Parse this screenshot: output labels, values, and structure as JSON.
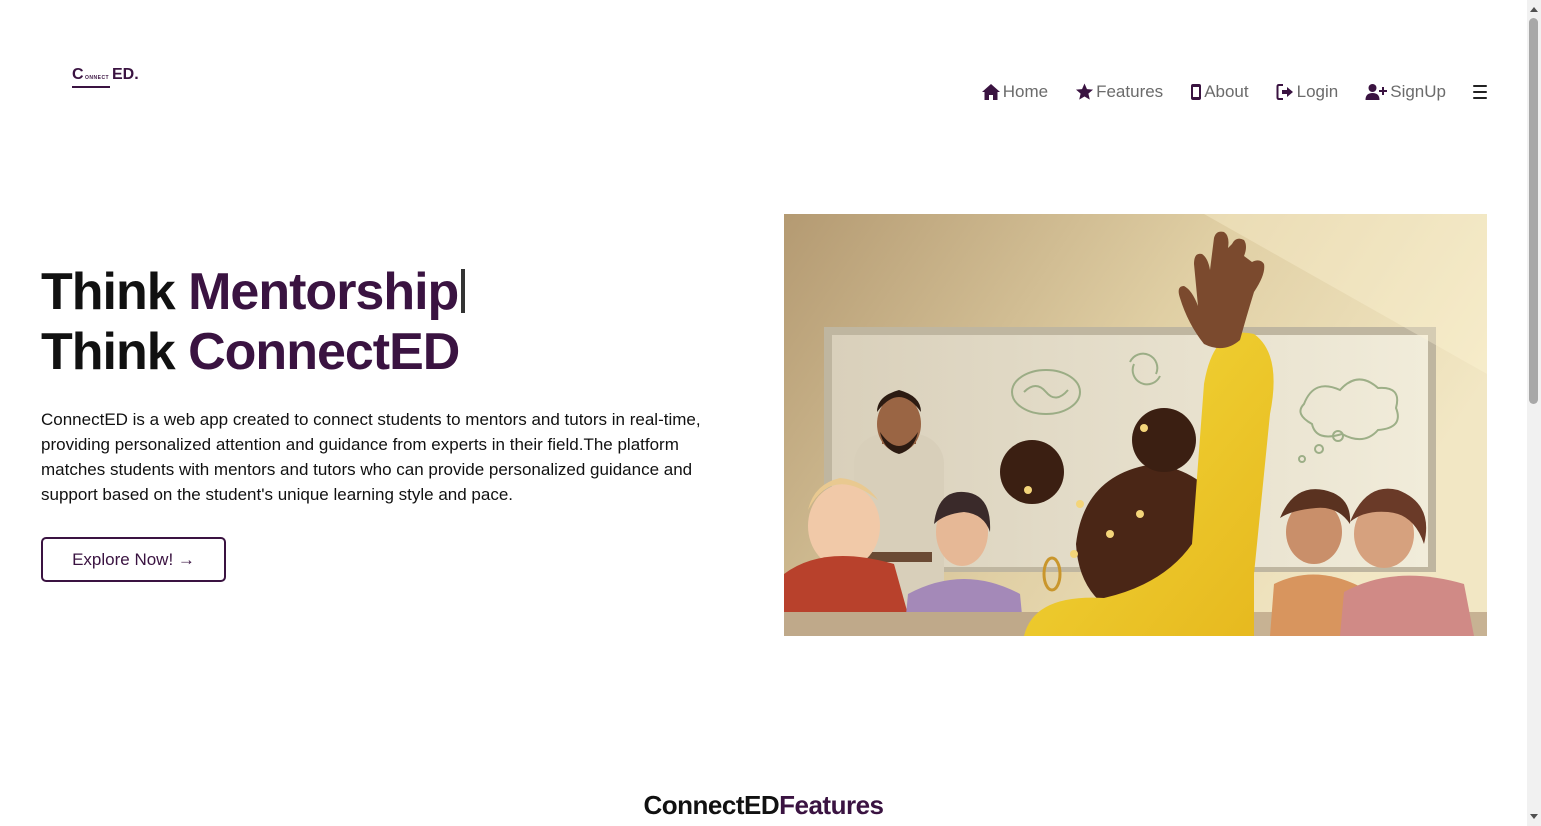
{
  "logo": {
    "c": "C",
    "small": "ONNECT",
    "ed": "ED."
  },
  "nav": {
    "items": [
      {
        "label": "Home",
        "icon": "home-icon"
      },
      {
        "label": "Features",
        "icon": "star-icon"
      },
      {
        "label": "About",
        "icon": "mobile-icon"
      },
      {
        "label": "Login",
        "icon": "login-icon"
      },
      {
        "label": "SignUp",
        "icon": "user-plus-icon"
      }
    ],
    "menu_icon": "hamburger-icon"
  },
  "hero": {
    "line1_prefix": "Think ",
    "line1_accent": "Mentorship",
    "line2_prefix": "Think ",
    "line2_accent": "ConnectED",
    "description": "ConnectED is a web app created to connect students to mentors and tutors in real-time, providing personalized attention and guidance from experts in their field.The platform matches students with mentors and tutors who can provide personalized guidance and support based on the student's unique learning style and pace.",
    "cta_label": "Explore Now! →"
  },
  "features": {
    "heading_prefix": "ConnectED",
    "heading_accent": "Features"
  },
  "colors": {
    "accent": "#3a1341",
    "nav_text": "#6b6b6b",
    "text": "#111111"
  }
}
